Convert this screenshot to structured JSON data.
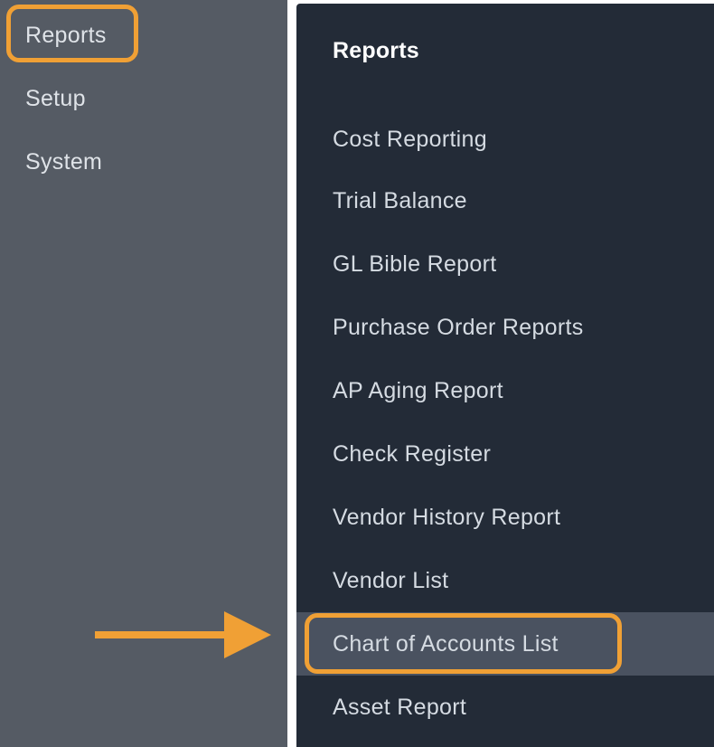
{
  "sidebar": {
    "items": [
      {
        "label": "Reports"
      },
      {
        "label": "Setup"
      },
      {
        "label": "System"
      }
    ]
  },
  "panel": {
    "title": "Reports",
    "items": [
      {
        "label": "Cost Reporting"
      },
      {
        "label": "Trial Balance"
      },
      {
        "label": "GL Bible Report"
      },
      {
        "label": "Purchase Order Reports"
      },
      {
        "label": "AP Aging Report"
      },
      {
        "label": "Check Register"
      },
      {
        "label": "Vendor History Report"
      },
      {
        "label": "Vendor List"
      },
      {
        "label": "Chart of Accounts List"
      },
      {
        "label": "Asset Report"
      }
    ],
    "selected": "Chart of Accounts List"
  },
  "annotations": {
    "highlight_color": "#f0a035",
    "arrow_icon": "arrow-right-icon"
  }
}
